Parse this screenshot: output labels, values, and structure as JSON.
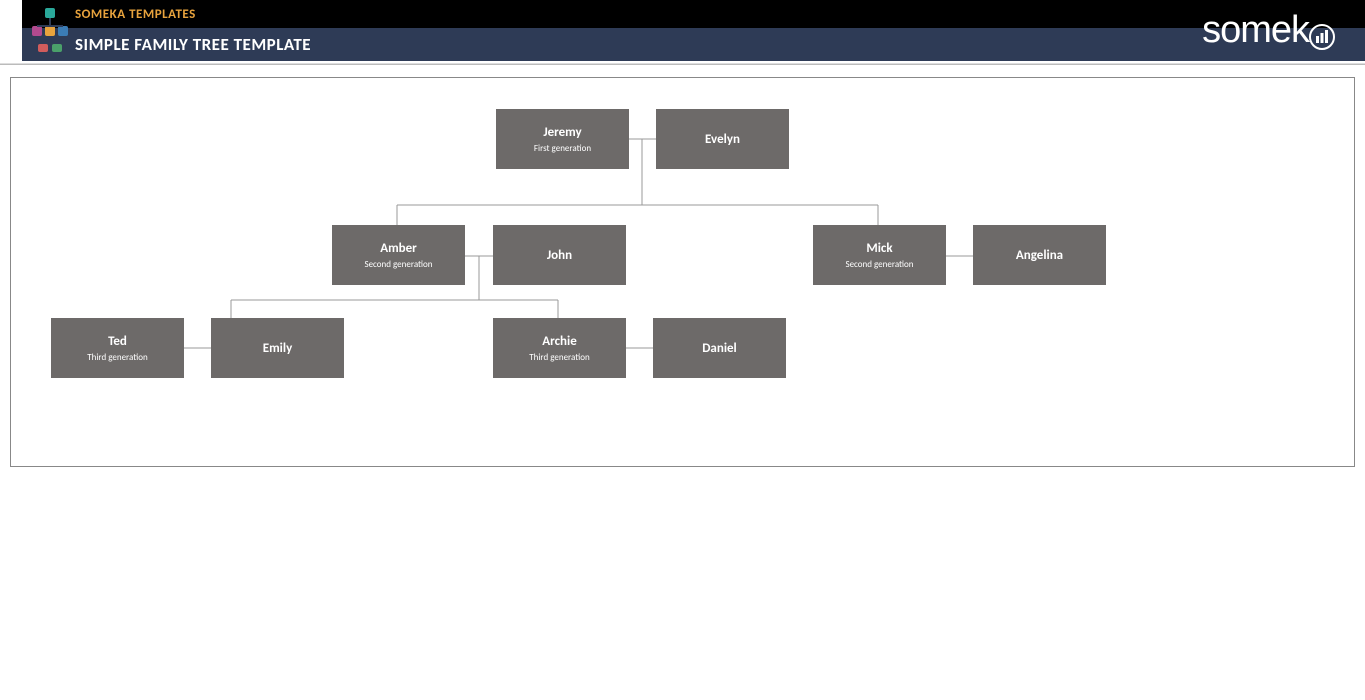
{
  "header": {
    "brand": "SOMEKA TEMPLATES",
    "title": "SIMPLE FAMILY TREE TEMPLATE",
    "logo_text": "someka"
  },
  "colors": {
    "node_bg": "#6d6a69",
    "header_top": "#000000",
    "header_bottom": "#2e3b56",
    "brand_color": "#e8a33d"
  },
  "tree": {
    "gen1": {
      "a": {
        "name": "Jeremy",
        "sub": "First generation"
      },
      "b": {
        "name": "Evelyn",
        "sub": ""
      }
    },
    "gen2": {
      "left": {
        "a": {
          "name": "Amber",
          "sub": "Second generation"
        },
        "b": {
          "name": "John",
          "sub": ""
        }
      },
      "right": {
        "a": {
          "name": "Mick",
          "sub": "Second generation"
        },
        "b": {
          "name": "Angelina",
          "sub": ""
        }
      }
    },
    "gen3": {
      "left": {
        "a": {
          "name": "Ted",
          "sub": "Third generation"
        },
        "b": {
          "name": "Emily",
          "sub": ""
        }
      },
      "right": {
        "a": {
          "name": "Archie",
          "sub": "Third generation"
        },
        "b": {
          "name": "Daniel",
          "sub": ""
        }
      }
    }
  }
}
